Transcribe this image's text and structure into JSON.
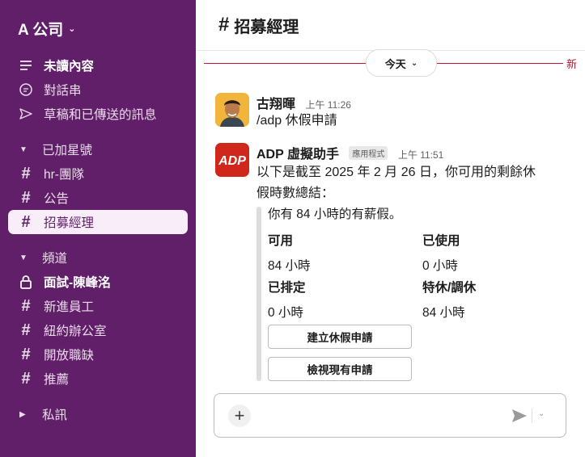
{
  "workspace": {
    "name": "A 公司"
  },
  "sidebar": {
    "nav": [
      {
        "label": "未讀內容",
        "icon": "unread-icon"
      },
      {
        "label": "對話串",
        "icon": "threads-icon"
      },
      {
        "label": "草稿和已傳送的訊息",
        "icon": "send-icon"
      }
    ],
    "starred": {
      "title": "已加星號",
      "channels": [
        "hr-團隊",
        "公告",
        "招募經理"
      ]
    },
    "channels": {
      "title": "頻道",
      "items": [
        {
          "label": "面試-陳峰洺",
          "private": true
        },
        {
          "label": "新進員工"
        },
        {
          "label": "紐約辦公室"
        },
        {
          "label": "開放職缺"
        },
        {
          "label": "推薦"
        }
      ]
    },
    "dms": {
      "title": "私訊"
    }
  },
  "channel": {
    "title": "招募經理"
  },
  "divider": {
    "day": "今天",
    "new": "新"
  },
  "messages": [
    {
      "author": "古翔暉",
      "time": "上午 11:26",
      "text": "/adp 休假申請"
    },
    {
      "author": "ADP 虛擬助手",
      "tag": "應用程式",
      "time": "上午 11:51",
      "text1": "以下是截至 2025 年 2 月 26 日，你可用的剩餘休",
      "text2": "假時數總結：",
      "attachment": {
        "summary": "你有 84 小時的有薪假。",
        "stats": [
          {
            "label": "可用",
            "value": "84 小時"
          },
          {
            "label": "已使用",
            "value": "0 小時"
          },
          {
            "label": "已排定",
            "value": "0 小時"
          },
          {
            "label": "特休/調休",
            "value": "84 小時"
          }
        ],
        "buttons": [
          "建立休假申請",
          "檢視現有申請"
        ]
      }
    }
  ],
  "colors": {
    "sidebar": "#611f69",
    "accent": "#c8102e",
    "adp": "#d0271d"
  }
}
